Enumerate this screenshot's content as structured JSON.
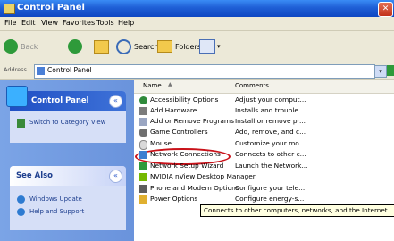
{
  "window": {
    "title": "Control Panel"
  },
  "menubar": {
    "items": [
      "File",
      "Edit",
      "View",
      "Favorites",
      "Tools",
      "Help"
    ]
  },
  "toolbar": {
    "back_label": "Back",
    "search_label": "Search",
    "folders_label": "Folders"
  },
  "address": {
    "label": "Address",
    "value": "Control Panel"
  },
  "sidebar": {
    "control_panel": {
      "title": "Control Panel",
      "switch_label": "Switch to Category View"
    },
    "see_also": {
      "title": "See Also",
      "links": [
        "Windows Update",
        "Help and Support"
      ]
    }
  },
  "list": {
    "headers": {
      "name": "Name",
      "comments": "Comments"
    },
    "rows": [
      {
        "name": "Accessibility Options",
        "comment": "Adjust your comput...",
        "icon": "accessibility-icon"
      },
      {
        "name": "Add Hardware",
        "comment": "Installs and trouble...",
        "icon": "hardware-icon"
      },
      {
        "name": "Add or Remove Programs",
        "comment": "Install or remove pr...",
        "icon": "programs-icon"
      },
      {
        "name": "Game Controllers",
        "comment": "Add, remove, and c...",
        "icon": "game-controller-icon"
      },
      {
        "name": "Mouse",
        "comment": "Customize your mo...",
        "icon": "mouse-icon"
      },
      {
        "name": "Network Connections",
        "comment": "Connects to other c...",
        "icon": "network-icon"
      },
      {
        "name": "Network Setup Wizard",
        "comment": "Launch the Network...",
        "icon": "network-wizard-icon"
      },
      {
        "name": "NVIDIA nView Desktop Manager",
        "comment": "",
        "icon": "nvidia-icon"
      },
      {
        "name": "Phone and Modem Options",
        "comment": "Configure your tele...",
        "icon": "phone-icon"
      },
      {
        "name": "Power Options",
        "comment": "Configure energy-s...",
        "icon": "power-icon"
      }
    ]
  },
  "tooltip": {
    "text": "Connects to other computers, networks, and the Internet."
  },
  "colors": {
    "titlebar": "#1f5fd6",
    "sidebar": "#7ba4e6",
    "highlight_ring": "#c9121a",
    "tooltip_bg": "#ffffe1"
  }
}
